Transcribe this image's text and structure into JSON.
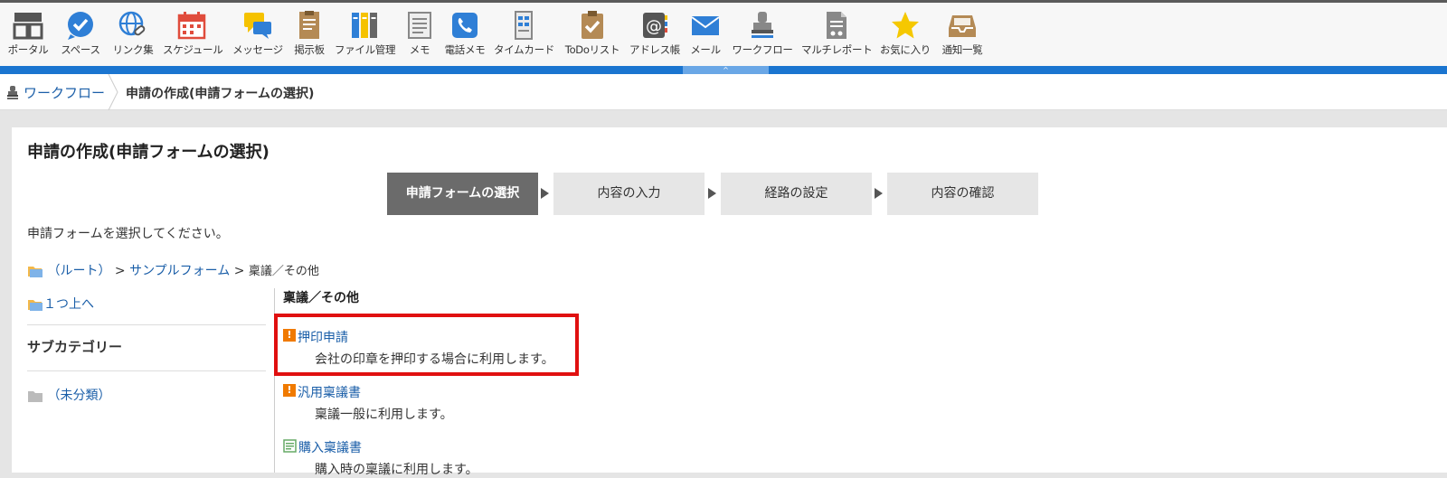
{
  "apps": [
    {
      "label": "ポータル",
      "icon": "portal-icon"
    },
    {
      "label": "スペース",
      "icon": "space-icon"
    },
    {
      "label": "リンク集",
      "icon": "link-icon"
    },
    {
      "label": "スケジュール",
      "icon": "calendar-icon"
    },
    {
      "label": "メッセージ",
      "icon": "message-icon"
    },
    {
      "label": "掲示板",
      "icon": "bulletin-icon"
    },
    {
      "label": "ファイル管理",
      "icon": "file-icon"
    },
    {
      "label": "メモ",
      "icon": "memo-icon"
    },
    {
      "label": "電話メモ",
      "icon": "phone-icon"
    },
    {
      "label": "タイムカード",
      "icon": "timecard-icon"
    },
    {
      "label": "ToDoリスト",
      "icon": "todo-icon"
    },
    {
      "label": "アドレス帳",
      "icon": "address-icon"
    },
    {
      "label": "メール",
      "icon": "mail-icon"
    },
    {
      "label": "ワークフロー",
      "icon": "workflow-icon"
    },
    {
      "label": "マルチレポート",
      "icon": "report-icon"
    },
    {
      "label": "お気に入り",
      "icon": "star-icon"
    },
    {
      "label": "通知一覧",
      "icon": "inbox-icon"
    }
  ],
  "collapse_symbol": "^",
  "breadcrumb": {
    "app": "ワークフロー",
    "current": "申請の作成(申請フォームの選択)"
  },
  "page": {
    "title": "申請の作成(申請フォームの選択)",
    "steps": [
      "申請フォームの選択",
      "内容の入力",
      "経路の設定",
      "内容の確認"
    ],
    "active_step": 0,
    "instruction": "申請フォームを選択してください。"
  },
  "path": {
    "root": "（ルート）",
    "sep": ">",
    "level1": "サンプルフォーム",
    "current": "稟議／その他"
  },
  "sidebar": {
    "up_link": "１つ上へ",
    "subcategory_title": "サブカテゴリー",
    "uncategorized": "（未分類）"
  },
  "category": {
    "title": "稟議／その他",
    "forms": [
      {
        "name": "押印申請",
        "desc": "会社の印章を押印する場合に利用します。"
      },
      {
        "name": "汎用稟議書",
        "desc": "稟議一般に利用します。"
      },
      {
        "name": "購入稟議書",
        "desc": "購入時の稟議に利用します。"
      }
    ]
  },
  "colors": {
    "accent": "#1b75d0",
    "link": "#1a5ea8",
    "highlight": "#e01010",
    "active_step": "#6b6b6b"
  }
}
